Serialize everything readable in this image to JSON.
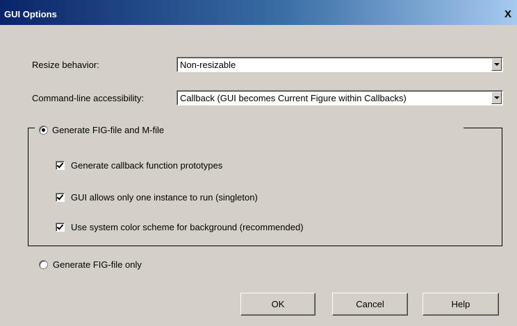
{
  "window": {
    "title": "GUI Options",
    "close_glyph": "X"
  },
  "resize": {
    "label": "Resize behavior:",
    "value": "Non-resizable"
  },
  "cmdline": {
    "label": "Command-line accessibility:",
    "value": "Callback (GUI becomes Current Figure within Callbacks)"
  },
  "generate_both": {
    "label": "Generate FIG-file and M-file",
    "selected": true,
    "options": [
      {
        "label": "Generate callback function prototypes",
        "checked": true
      },
      {
        "label": "GUI allows only one instance to run (singleton)",
        "checked": true
      },
      {
        "label": "Use system color scheme for background (recommended)",
        "checked": true
      }
    ]
  },
  "generate_fig_only": {
    "label": "Generate FIG-file only",
    "selected": false
  },
  "buttons": {
    "ok": "OK",
    "cancel": "Cancel",
    "help": "Help"
  }
}
